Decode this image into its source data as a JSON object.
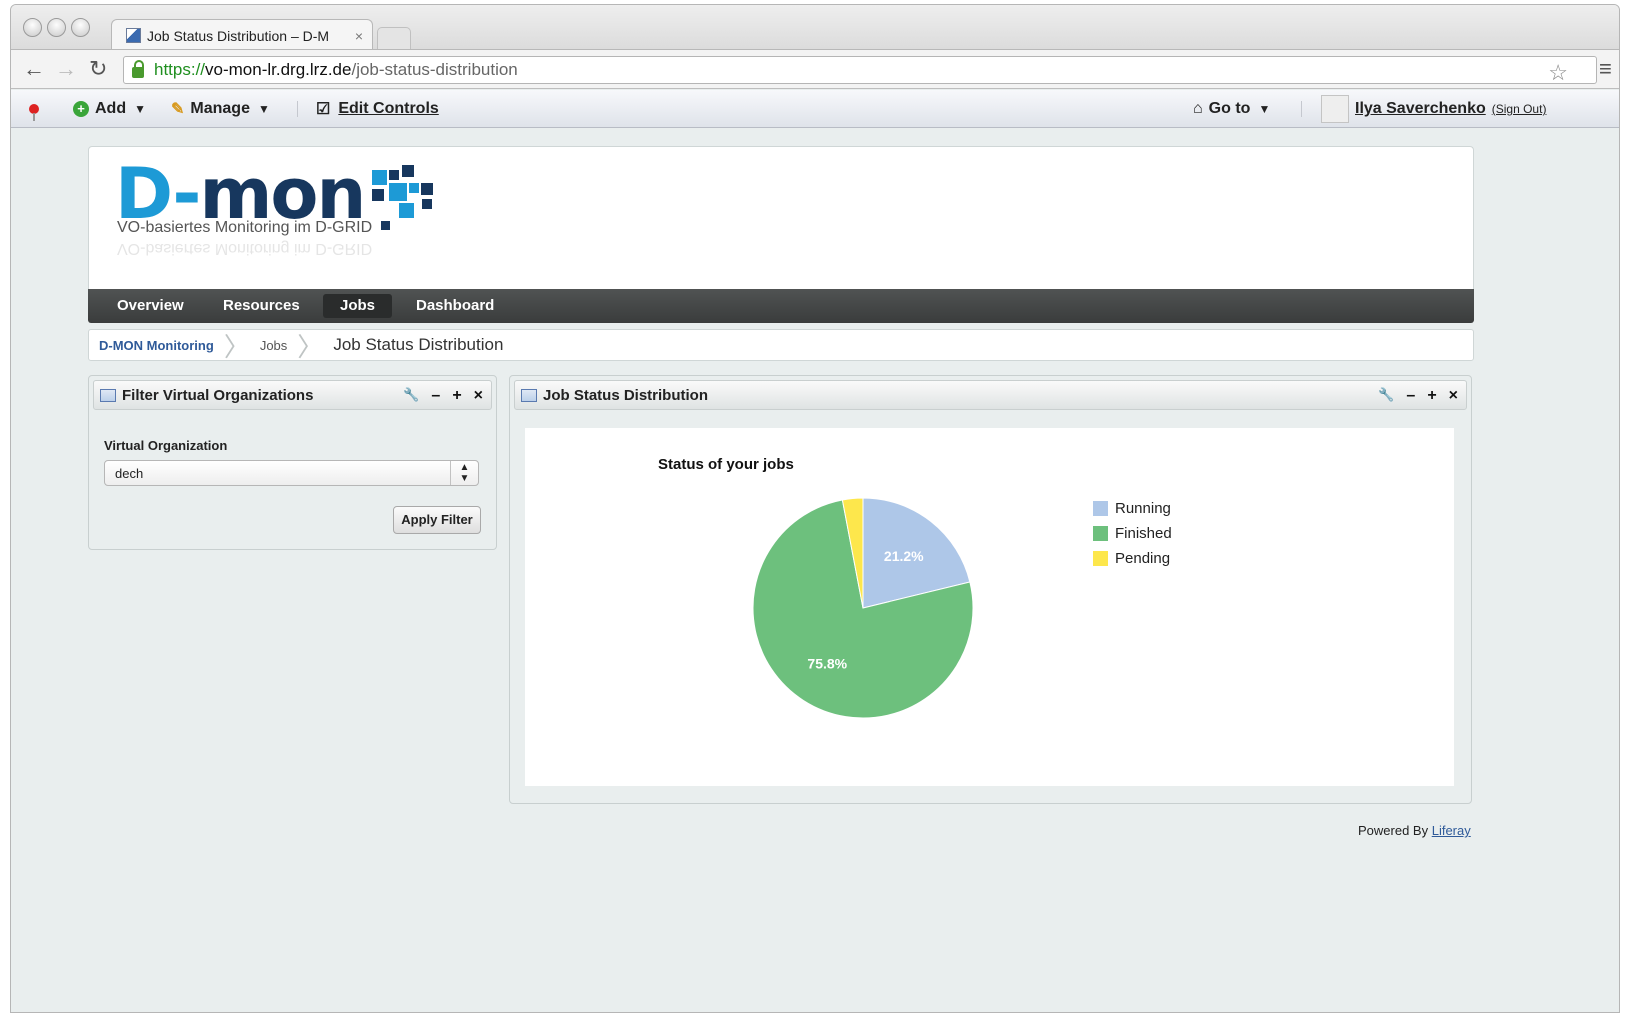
{
  "browser": {
    "tab_title": "Job Status Distribution – D-M",
    "tab_close": "×",
    "url_scheme": "https://",
    "url_host": "vo-mon-lr.drg.lrz.de",
    "url_path": "/job-status-distribution"
  },
  "dockbar": {
    "add_label": "Add",
    "manage_label": "Manage",
    "edit_controls_label": "Edit Controls",
    "goto_label": "Go to",
    "user_name": "Ilya Saverchenko",
    "sign_out_label": "(Sign Out)"
  },
  "header": {
    "logo_part1": "D-",
    "logo_part2": "mon",
    "logo_subtitle": "VO-basiertes Monitoring im D-GRID"
  },
  "nav": {
    "items": [
      {
        "label": "Overview"
      },
      {
        "label": "Resources"
      },
      {
        "label": "Jobs"
      },
      {
        "label": "Dashboard"
      }
    ],
    "active": "Jobs"
  },
  "breadcrumb": {
    "root": "D-MON Monitoring",
    "parent": "Jobs",
    "current": "Job Status Distribution"
  },
  "filter_portlet": {
    "title": "Filter Virtual Organizations",
    "vo_label": "Virtual Organization",
    "vo_value": "dech",
    "apply_label": "Apply Filter"
  },
  "chart_portlet": {
    "title": "Job Status Distribution"
  },
  "portlet_tools": {
    "wrench": "🔧",
    "minimize": "–",
    "maximize": "+",
    "close": "×"
  },
  "chart_data": {
    "type": "pie",
    "title": "Status of your jobs",
    "categories": [
      "Running",
      "Finished",
      "Pending"
    ],
    "values": [
      21.2,
      75.8,
      3.0
    ],
    "labels": [
      "21.2%",
      "75.8%",
      ""
    ],
    "colors": [
      "#aec7e8",
      "#6dc07d",
      "#fde74c"
    ],
    "legend_position": "right"
  },
  "footer": {
    "powered_by": "Powered By",
    "liferay": "Liferay"
  }
}
